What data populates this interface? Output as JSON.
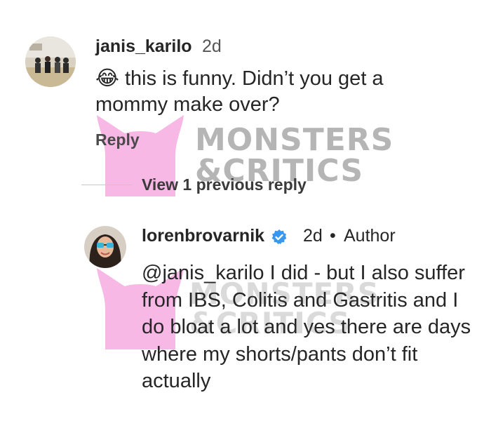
{
  "comment": {
    "username": "janis_karilo",
    "time": "2d",
    "emoji": "😂",
    "text": "this is funny. Didn’t you get a mommy make over?",
    "reply_label": "Reply"
  },
  "thread": {
    "view_previous_label": "View 1 previous reply"
  },
  "reply": {
    "username": "lorenbrovarnik",
    "time": "2d",
    "separator": "•",
    "author_label": "Author",
    "mention": "@janis_karilo",
    "text": "I did - but I also suffer from IBS, Colitis and Gastritis and I do bloat a lot and yes there are days where my shorts/pants don’t fit actually"
  },
  "watermark": {
    "line1": "MONSTERS",
    "line2": "&CRITICS",
    "color": "#f7b8e6"
  },
  "icons": {
    "verified": "verified-badge-icon",
    "watermark": "monster-logo-icon"
  },
  "colors": {
    "verified_badge": "#3897f0",
    "text": "#262626",
    "divider": "#c7c7c7"
  }
}
